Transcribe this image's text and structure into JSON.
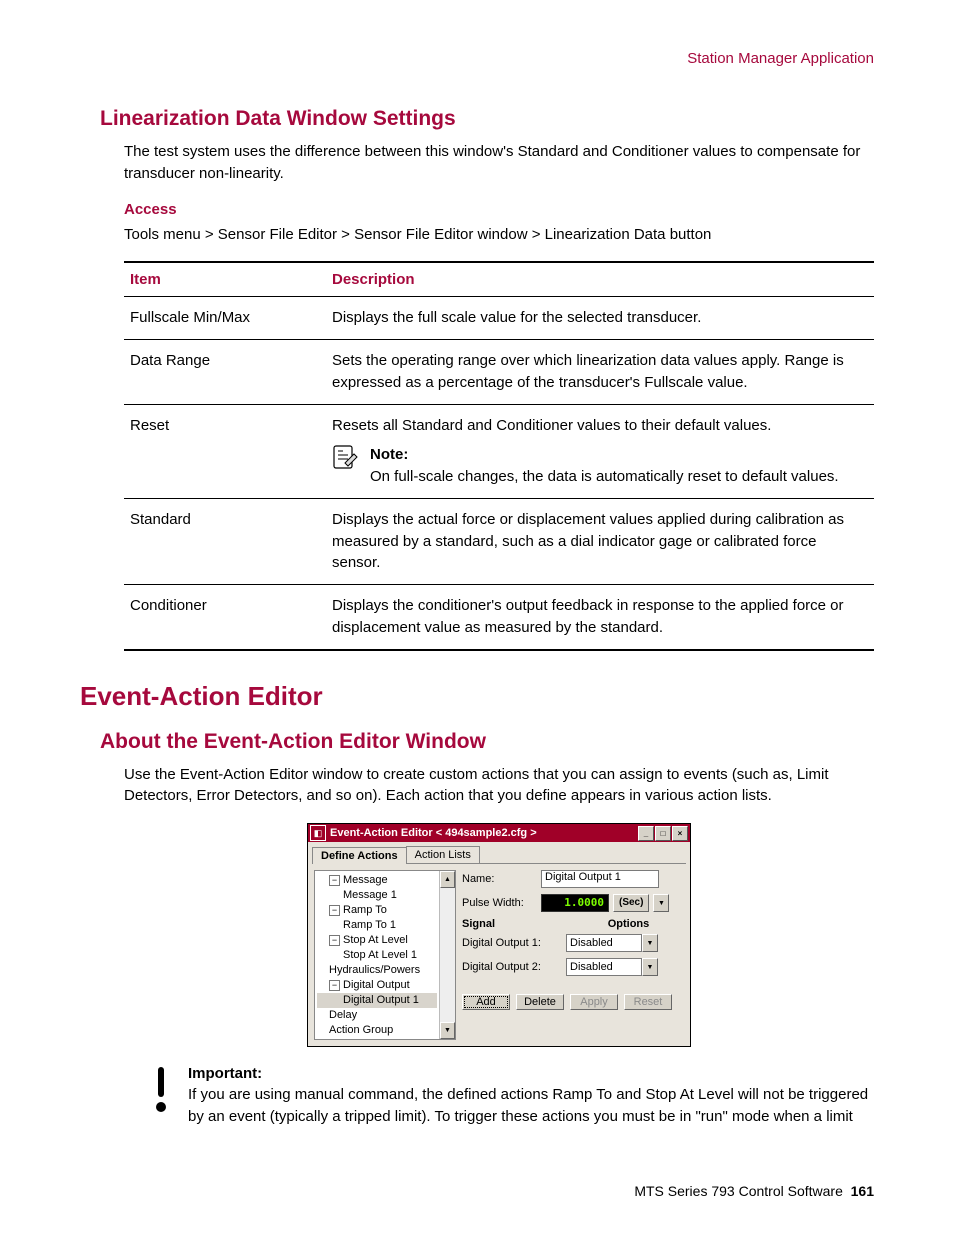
{
  "running_head": "Station Manager Application",
  "section1": {
    "title": "Linearization Data Window Settings",
    "intro": "The test system uses the difference between this window's Standard and Conditioner values to compensate for transducer non-linearity.",
    "access_label": "Access",
    "access_path": "Tools menu > Sensor File Editor > Sensor File Editor window > Linearization Data button",
    "table": {
      "headers": {
        "item": "Item",
        "desc": "Description"
      },
      "rows": {
        "r1": {
          "item": "Fullscale Min/Max",
          "desc": "Displays the full scale value for the selected transducer."
        },
        "r2": {
          "item": "Data Range",
          "desc": "Sets the operating range over which linearization data values apply. Range is expressed as a percentage of the transducer's Fullscale value."
        },
        "r3": {
          "item": "Reset",
          "desc_a": "Resets all Standard and Conditioner values to their default values.",
          "note_label": "Note:",
          "note_body": "On full-scale changes, the data is automatically reset to default values."
        },
        "r4": {
          "item": "Standard",
          "desc": "Displays the actual force or displacement values applied during calibration as measured by a standard, such as a dial indicator gage or calibrated force sensor."
        },
        "r5": {
          "item": "Conditioner",
          "desc": "Displays the conditioner's output feedback in response to the applied force or displacement value as measured by the standard."
        }
      }
    }
  },
  "section2": {
    "h1": "Event-Action Editor",
    "h2": "About the Event-Action Editor Window",
    "intro": "Use the Event-Action Editor window to create custom actions that you can assign to events (such as, Limit Detectors, Error Detectors, and so on). Each action that you define appears in various action lists.",
    "important_label": "Important:",
    "important_body": "If you are using manual command, the defined actions Ramp To and Stop At Level will not be triggered by an event (typically a tripped limit). To trigger these actions you must be in \"run\" mode when a limit"
  },
  "win": {
    "title": "Event-Action Editor < 494sample2.cfg >",
    "tabs": {
      "t1": "Define Actions",
      "t2": "Action Lists"
    },
    "tree": {
      "n1": "Message",
      "n1a": "Message 1",
      "n2": "Ramp To",
      "n2a": "Ramp To 1",
      "n3": "Stop At Level",
      "n3a": "Stop At Level 1",
      "n4": "Hydraulics/Powers",
      "n5": "Digital Output",
      "n5a": "Digital Output 1",
      "n6": "Delay",
      "n7": "Action Group"
    },
    "form": {
      "name_lbl": "Name:",
      "name_val": "Digital Output 1",
      "pw_lbl": "Pulse Width:",
      "pw_val": "1.0000",
      "pw_unit": "(Sec)",
      "sig_hdr": "Signal",
      "opt_hdr": "Options",
      "do1_lbl": "Digital Output 1:",
      "do1_val": "Disabled",
      "do2_lbl": "Digital Output 2:",
      "do2_val": "Disabled",
      "btn_add": "Add",
      "btn_del": "Delete",
      "btn_apply": "Apply",
      "btn_reset": "Reset"
    }
  },
  "footer": {
    "text": "MTS Series 793 Control Software",
    "page": "161"
  }
}
